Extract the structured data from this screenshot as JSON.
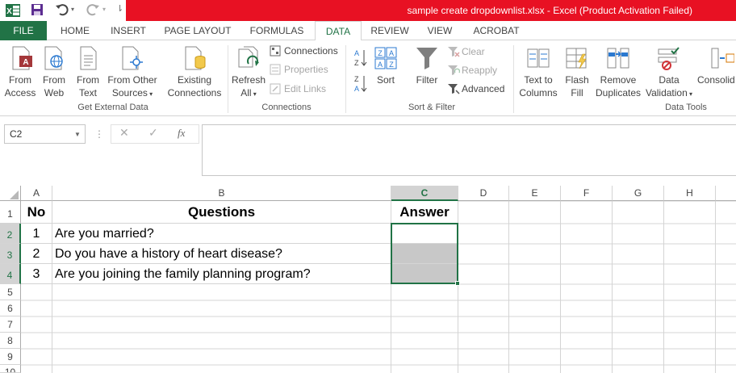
{
  "window": {
    "title": "sample create dropdownlist.xlsx -  Excel (Product Activation Failed)"
  },
  "tabs": [
    {
      "label": "FILE"
    },
    {
      "label": "HOME"
    },
    {
      "label": "INSERT"
    },
    {
      "label": "PAGE LAYOUT"
    },
    {
      "label": "FORMULAS"
    },
    {
      "label": "DATA"
    },
    {
      "label": "REVIEW"
    },
    {
      "label": "VIEW"
    },
    {
      "label": "ACROBAT"
    }
  ],
  "ribbon": {
    "get_external_data": {
      "label": "Get External Data",
      "from_access": [
        "From",
        "Access"
      ],
      "from_web": [
        "From",
        "Web"
      ],
      "from_text": [
        "From",
        "Text"
      ],
      "from_other": [
        "From Other",
        "Sources"
      ],
      "existing": [
        "Existing",
        "Connections"
      ]
    },
    "connections": {
      "label": "Connections",
      "refresh": [
        "Refresh",
        "All"
      ],
      "connections": "Connections",
      "properties": "Properties",
      "edit_links": "Edit Links"
    },
    "sort_filter": {
      "label": "Sort & Filter",
      "sort": "Sort",
      "filter": "Filter",
      "clear": "Clear",
      "reapply": "Reapply",
      "advanced": "Advanced"
    },
    "data_tools": {
      "label": "Data Tools",
      "text_to_columns": [
        "Text to",
        "Columns"
      ],
      "flash_fill": [
        "Flash",
        "Fill"
      ],
      "remove_duplicates": [
        "Remove",
        "Duplicates"
      ],
      "data_validation": [
        "Data",
        "Validation"
      ],
      "consolidate": "Consolid"
    }
  },
  "formula_bar": {
    "name_box": "C2",
    "fx": "fx",
    "value": ""
  },
  "columns": [
    "A",
    "B",
    "C",
    "D",
    "E",
    "F",
    "G",
    "H"
  ],
  "rows": [
    "1",
    "2",
    "3",
    "4",
    "5",
    "6",
    "7",
    "8",
    "9",
    "10"
  ],
  "sheet": {
    "header": {
      "no": "No",
      "questions": "Questions",
      "answer": "Answer"
    },
    "data": [
      {
        "no": "1",
        "question": "Are you married?"
      },
      {
        "no": "2",
        "question": "Do you have a history of heart disease?"
      },
      {
        "no": "3",
        "question": "Are you joining the family planning program?"
      }
    ]
  },
  "colors": {
    "accent": "#217346",
    "title_bar": "#e81123",
    "selected_fill": "#c8c8c8"
  }
}
